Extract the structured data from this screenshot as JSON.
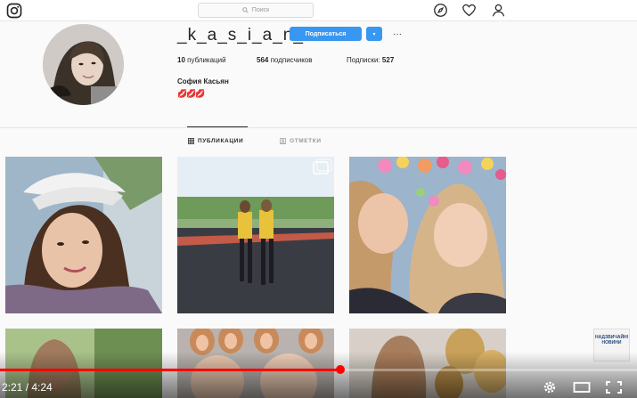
{
  "search": {
    "placeholder": "Поиск"
  },
  "profile": {
    "username": "_k_a_s_i_a_n_",
    "follow_label": "Подписаться",
    "more_label": "···",
    "dropdown_label": "▾",
    "stats": {
      "posts": {
        "count": "10",
        "label": "публикаций"
      },
      "followers": {
        "count": "564",
        "label": "подписчиков"
      },
      "following": {
        "label": "Подписки:",
        "count": "527"
      }
    },
    "full_name": "София Касьян",
    "bio": "💋💋💋"
  },
  "tabs": [
    {
      "label": "ПУБЛИКАЦИИ",
      "active": true
    },
    {
      "label": "ОТМЕТКИ",
      "active": false
    }
  ],
  "posts": [
    {
      "kind": "selfie-cap"
    },
    {
      "kind": "two-girls-track"
    },
    {
      "kind": "flower-crown-filter"
    },
    {
      "kind": "park-trees"
    },
    {
      "kind": "dog-ears-filter"
    },
    {
      "kind": "balloons"
    }
  ],
  "video": {
    "time_current": "2:21",
    "time_separator": " / ",
    "time_total": "4:24",
    "progress_fraction": 0.534
  },
  "watermark": {
    "line1": "НАДЗВИЧАЙНІ",
    "line2": "НОВИНИ"
  },
  "colors": {
    "accent": "#3897f0",
    "progress": "#ff0000"
  }
}
